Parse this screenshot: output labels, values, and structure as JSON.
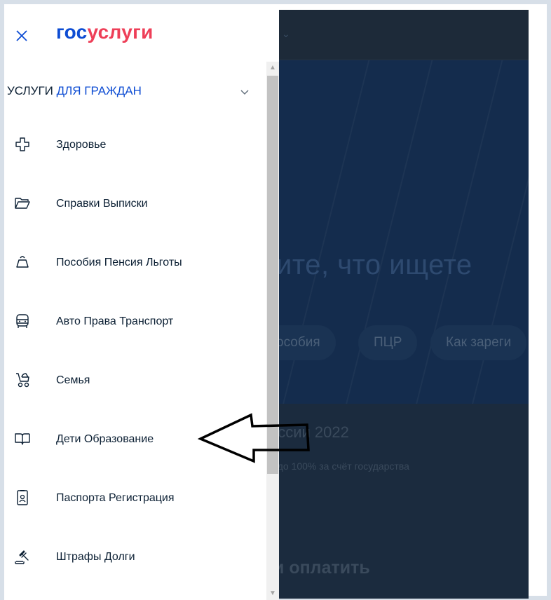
{
  "logo": {
    "part1": "гос",
    "part2": "услуги"
  },
  "category": {
    "prefix": "УСЛУГИ ",
    "accent": "ДЛЯ ГРАЖДАН"
  },
  "menu": {
    "items": [
      {
        "label": "Здоровье",
        "icon": "health-cross-icon"
      },
      {
        "label": "Справки Выписки",
        "icon": "folder-icon"
      },
      {
        "label": "Пособия Пенсия Льготы",
        "icon": "benefits-bell-icon"
      },
      {
        "label": "Авто Права Транспорт",
        "icon": "car-icon"
      },
      {
        "label": "Семья",
        "icon": "stroller-icon"
      },
      {
        "label": "Дети Образование",
        "icon": "book-icon"
      },
      {
        "label": "Паспорта Регистрация",
        "icon": "passport-icon"
      },
      {
        "label": "Штрафы Долги",
        "icon": "gavel-icon"
      }
    ]
  },
  "background": {
    "hero_text": "ите, что ищете",
    "chips": [
      "особия",
      "ПЦР",
      "Как зареги"
    ],
    "promo_title": "ессии 2022",
    "promo_sub": "й до 100% за счёт государства",
    "section_title": "и оплатить"
  },
  "colors": {
    "logo_blue": "#0d4cd3",
    "logo_red": "#ee3f58",
    "text": "#0b1f33",
    "overlay": "#1b2b3e"
  }
}
